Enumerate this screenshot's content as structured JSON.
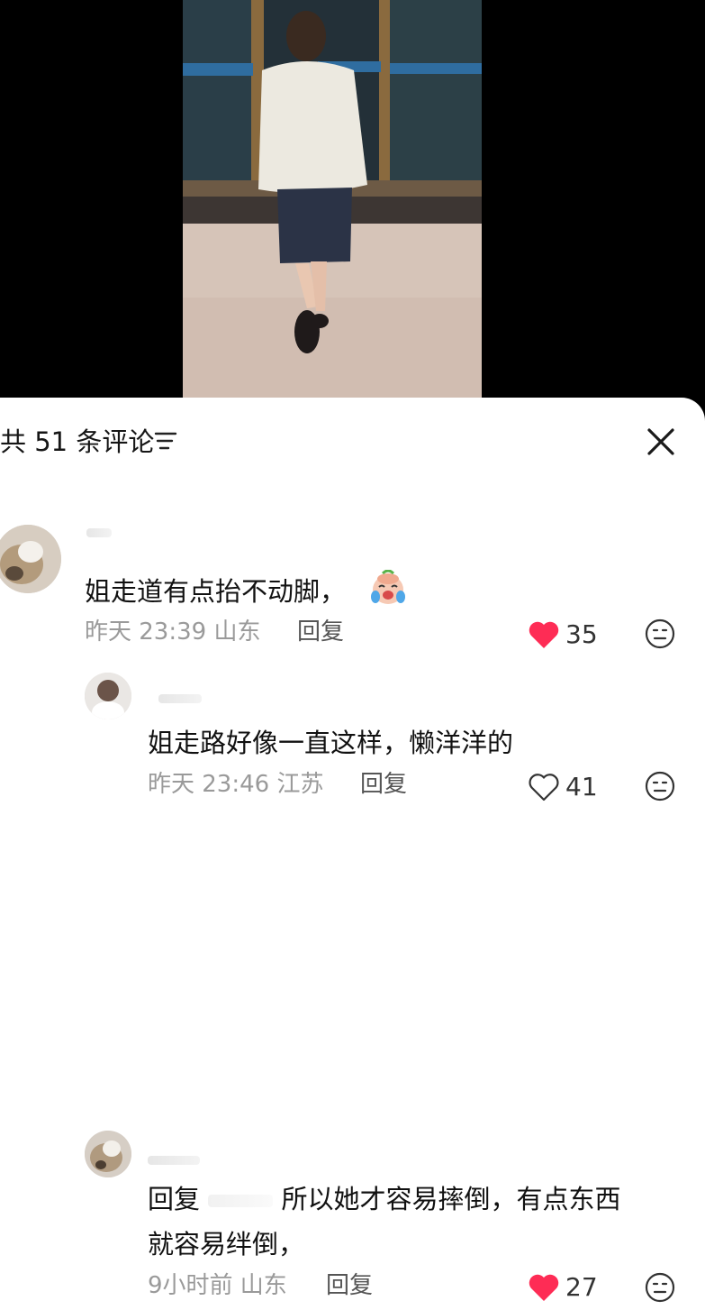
{
  "header": {
    "title": "共 51 条评论"
  },
  "comments": [
    {
      "text": "姐走道有点抬不动脚，",
      "meta": "昨天 23:39 山东",
      "reply_label": "回复",
      "likes": "35",
      "liked": true
    },
    {
      "text": "姐走路好像一直这样，懒洋洋的",
      "meta": "昨天 23:46 江苏",
      "reply_label": "回复",
      "likes": "41",
      "liked": false
    },
    {
      "reply_prefix": "回复",
      "text": "所以她才容易摔倒，有点东西",
      "text_line2": "就容易绊倒，",
      "meta": "9小时前 山东",
      "reply_label": "回复",
      "likes": "27",
      "liked": true
    }
  ],
  "colors": {
    "like_red": "#fe2c55",
    "sheet_bg": "#ffffff",
    "meta_gray": "#9a9a9a"
  },
  "icons": [
    "filter-icon",
    "close-icon",
    "heart-filled-icon",
    "heart-outline-icon",
    "dislike-face-icon",
    "crying-emoji-icon"
  ]
}
